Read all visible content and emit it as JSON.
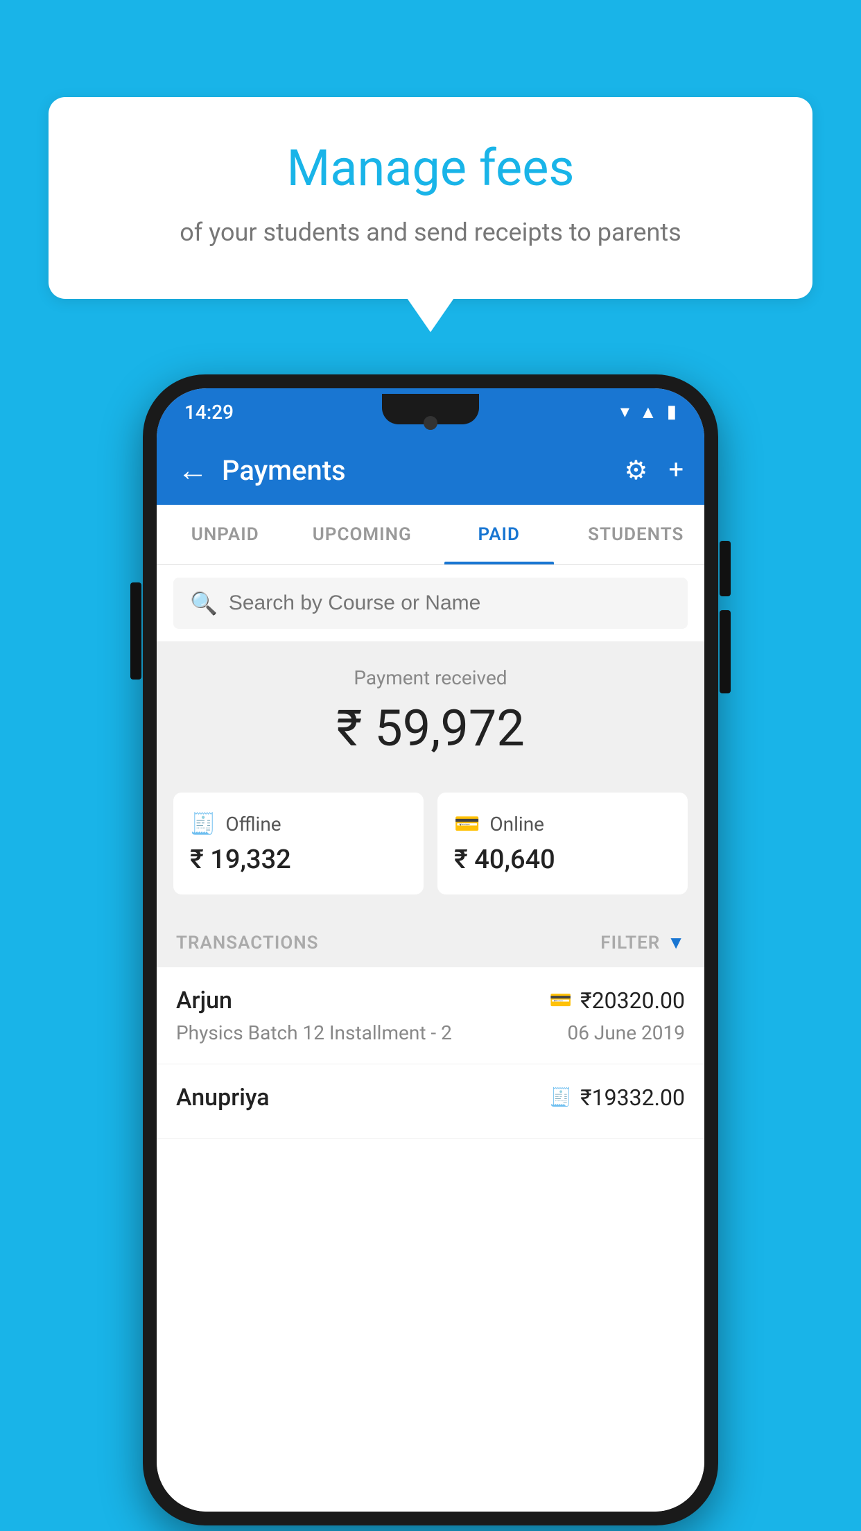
{
  "bubble": {
    "title": "Manage fees",
    "subtitle": "of your students and send receipts to parents"
  },
  "statusBar": {
    "time": "14:29",
    "icons": [
      "wifi",
      "signal",
      "battery"
    ]
  },
  "header": {
    "title": "Payments",
    "backLabel": "←",
    "settingsLabel": "⚙",
    "addLabel": "+"
  },
  "tabs": [
    {
      "label": "UNPAID",
      "active": false
    },
    {
      "label": "UPCOMING",
      "active": false
    },
    {
      "label": "PAID",
      "active": true
    },
    {
      "label": "STUDENTS",
      "active": false
    }
  ],
  "search": {
    "placeholder": "Search by Course or Name"
  },
  "paymentSummary": {
    "label": "Payment received",
    "amount": "₹ 59,972"
  },
  "paymentCards": [
    {
      "icon": "🧾",
      "label": "Offline",
      "amount": "₹ 19,332"
    },
    {
      "icon": "💳",
      "label": "Online",
      "amount": "₹ 40,640"
    }
  ],
  "transactionsSection": {
    "label": "TRANSACTIONS",
    "filterLabel": "FILTER",
    "filterIcon": "▼"
  },
  "transactions": [
    {
      "name": "Arjun",
      "paymentIcon": "💳",
      "amount": "₹20320.00",
      "course": "Physics Batch 12 Installment - 2",
      "date": "06 June 2019"
    },
    {
      "name": "Anupriya",
      "paymentIcon": "🧾",
      "amount": "₹19332.00",
      "course": "",
      "date": ""
    }
  ],
  "colors": {
    "accent": "#1976d2",
    "background": "#19b4e8",
    "headerBg": "#1976d2",
    "filterIconColor": "#1976d2"
  }
}
